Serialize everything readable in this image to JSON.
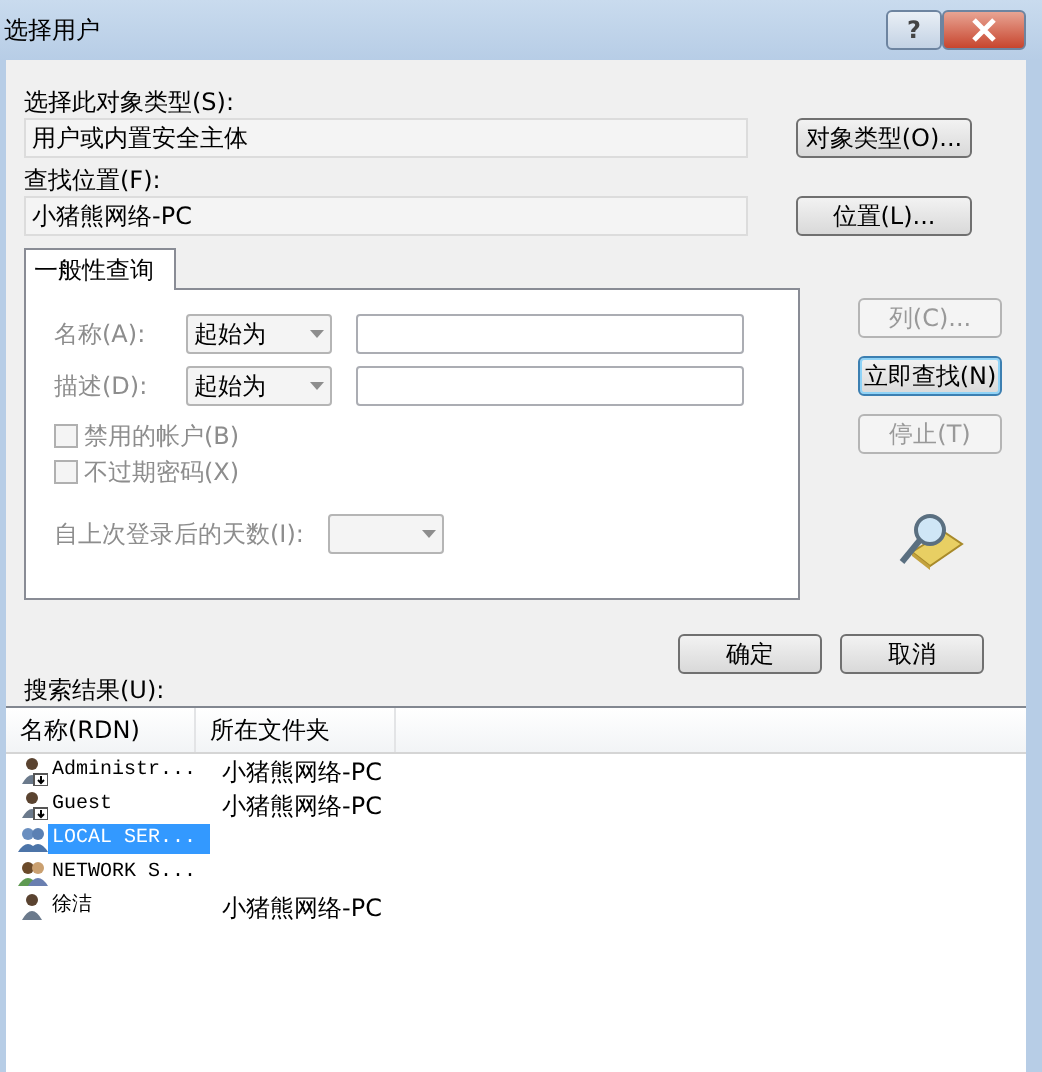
{
  "window": {
    "title": "选择用户",
    "help": "?"
  },
  "object_type": {
    "label": "选择此对象类型(S):",
    "value": "用户或内置安全主体",
    "button": "对象类型(O)..."
  },
  "location": {
    "label": "查找位置(F):",
    "value": "小猪熊网络-PC",
    "button": "位置(L)..."
  },
  "tabs": [
    {
      "label": "一般性查询",
      "selected": true
    }
  ],
  "query": {
    "disabled": true,
    "fields": [
      {
        "label": "名称(A):",
        "operator": "起始为"
      },
      {
        "label": "描述(D):",
        "operator": "起始为"
      }
    ],
    "checkboxes": [
      {
        "label": "禁用的帐户(B)",
        "checked": false
      },
      {
        "label": "不过期密码(X)",
        "checked": false
      }
    ],
    "days_label": "自上次登录后的天数(I):"
  },
  "side_buttons": [
    {
      "label": "列(C)...",
      "disabled": true,
      "default": false
    },
    {
      "label": "立即查找(N)",
      "disabled": false,
      "default": true
    },
    {
      "label": "停止(T)",
      "disabled": true,
      "default": false
    }
  ],
  "buttons": [
    "确定",
    "取消"
  ],
  "results": {
    "label": "搜索结果(U):",
    "columns": [
      "名称(RDN)",
      "所在文件夹"
    ],
    "rows": [
      {
        "kind": "disabled-user",
        "name": "Administr...",
        "folder": "小猪熊网络-PC",
        "selected": false
      },
      {
        "kind": "disabled-user",
        "name": "Guest",
        "folder": "小猪熊网络-PC",
        "selected": false
      },
      {
        "kind": "service",
        "name": "LOCAL SER...",
        "selected": true
      },
      {
        "kind": "group",
        "name": "NETWORK S...",
        "selected": false
      },
      {
        "kind": "user",
        "name": "徐洁",
        "folder": "小猪熊网络-PC",
        "selected": false
      }
    ]
  }
}
